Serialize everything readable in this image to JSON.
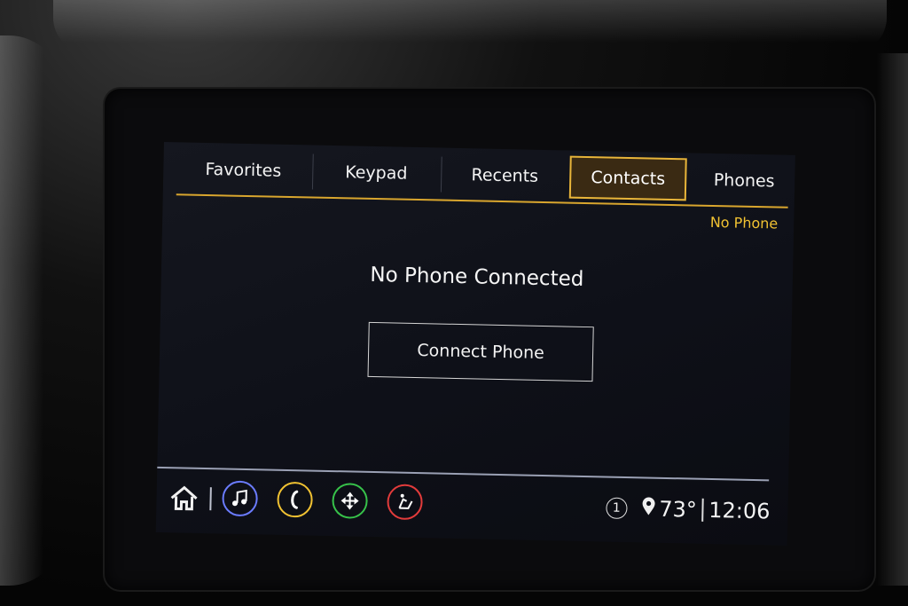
{
  "tabs": [
    {
      "label": "Favorites",
      "active": false
    },
    {
      "label": "Keypad",
      "active": false
    },
    {
      "label": "Recents",
      "active": false
    },
    {
      "label": "Contacts",
      "active": true
    },
    {
      "label": "Phones",
      "active": false
    }
  ],
  "phone_status": "No Phone",
  "main": {
    "title": "No Phone Connected",
    "connect_button": "Connect Phone"
  },
  "bottom_bar": {
    "icons": [
      {
        "name": "home-icon"
      },
      {
        "name": "music-icon",
        "color": "#6b7cff"
      },
      {
        "name": "phone-icon",
        "color": "#f1c232"
      },
      {
        "name": "navigation-icon",
        "color": "#37c24a"
      },
      {
        "name": "seat-icon",
        "color": "#e23b3b"
      }
    ],
    "notification_count": "1",
    "temperature": "73°",
    "time": "12:06"
  },
  "colors": {
    "accent": "#e8b53a",
    "active_tab_bg": "#3a2a13",
    "screen_bg": "#0e1018"
  }
}
